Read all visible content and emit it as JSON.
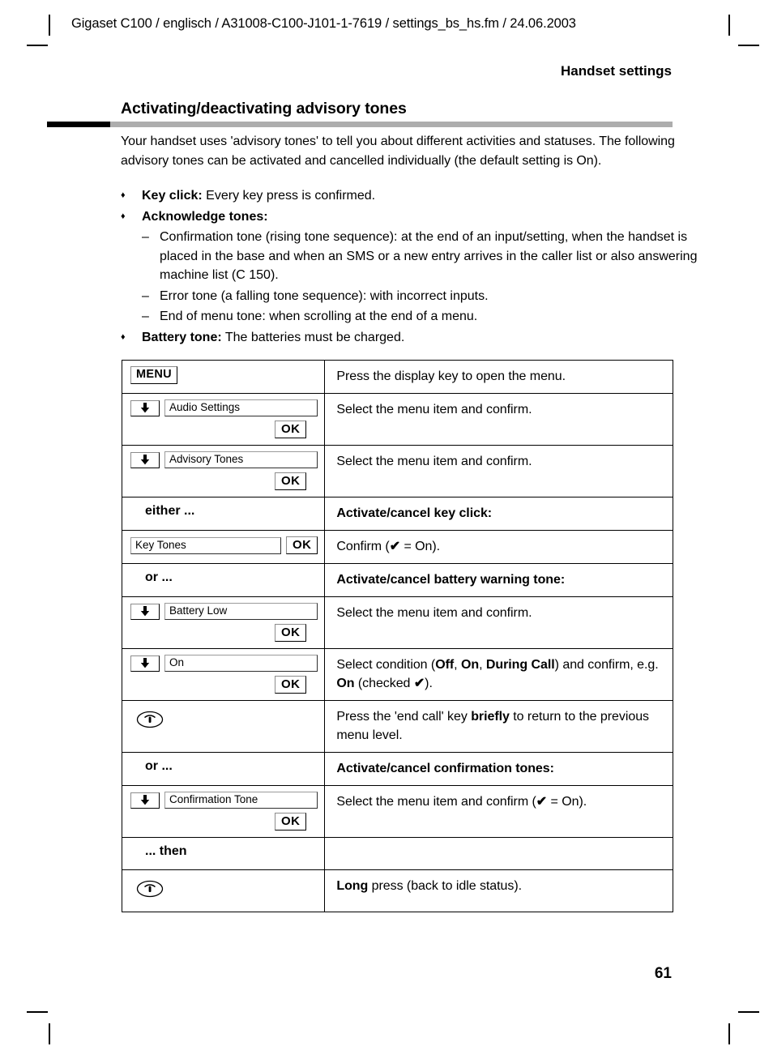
{
  "document_header": "Gigaset C100 / englisch / A31008-C100-J101-1-7619 / settings_bs_hs.fm / 24.06.2003",
  "section_header": "Handset settings",
  "chapter_title": "Activating/deactivating advisory tones",
  "intro_paragraph": "Your handset uses 'advisory tones' to tell you about different activities and statuses. The following advisory tones can be activated and cancelled individually (the default setting is On).",
  "bullets": [
    {
      "marker": "♦",
      "bold": "Key click:",
      "rest": " Every key press is confirmed."
    },
    {
      "marker": "♦",
      "bold": "Acknowledge tones:",
      "rest": ""
    },
    {
      "marker": "–",
      "bold": "",
      "rest": "Confirmation tone (rising tone sequence): at the end of an input/setting, when the handset is placed in the base and when an SMS or a new entry arrives in the caller list or also answering machine list (C 150)."
    },
    {
      "marker": "–",
      "bold": "",
      "rest": "Error tone (a falling tone sequence): with incorrect inputs."
    },
    {
      "marker": "–",
      "bold": "",
      "rest": "End of menu tone: when scrolling at the end of a menu."
    },
    {
      "marker": "♦",
      "bold": "Battery tone:",
      "rest": " The batteries must be charged."
    }
  ],
  "keys": {
    "menu_label": "MENU",
    "ok_label": "OK",
    "arrow_icon": "arrow-down-icon",
    "end_call_icon": "end-call-key-icon",
    "check_glyph": "✔"
  },
  "procedure_rows": [
    {
      "id": "menu",
      "left_type": "menu-key",
      "menu_key": "MENU",
      "right": "Press the display key to open the menu."
    },
    {
      "id": "audio-settings",
      "left_type": "arrow-item-ok",
      "display_item": "Audio Settings",
      "ok": "OK",
      "right": "Select the menu item and confirm."
    },
    {
      "id": "advisory-tones",
      "left_type": "arrow-item-ok",
      "display_item": "Advisory Tones",
      "ok": "OK",
      "right": "Select the menu item and confirm."
    },
    {
      "id": "either",
      "left_type": "label",
      "left": "either ...",
      "right_type": "label",
      "right": "Activate/cancel key click:"
    },
    {
      "id": "key-tones",
      "left_type": "item-ok-inline",
      "display_item": "Key Tones",
      "ok": "OK",
      "right_prefix": "Confirm (",
      "right_suffix": " = On)."
    },
    {
      "id": "or-battery",
      "left_type": "label",
      "left": "or ...",
      "right_type": "label",
      "right": "Activate/cancel battery warning tone:"
    },
    {
      "id": "battery-low",
      "left_type": "arrow-item-ok",
      "display_item": "Battery Low",
      "ok": "OK",
      "right": "Select the menu item and confirm."
    },
    {
      "id": "condition-on",
      "left_type": "arrow-item-ok",
      "display_item": "On",
      "ok": "OK",
      "right_rich": true
    },
    {
      "id": "end-call-brief",
      "left_type": "end-call",
      "right_rich": true
    },
    {
      "id": "or-confirmation",
      "left_type": "label",
      "left": "or ...",
      "right_type": "label",
      "right": "Activate/cancel confirmation tones:"
    },
    {
      "id": "confirmation-tone",
      "left_type": "arrow-item-ok",
      "display_item": "Confirmation Tone",
      "ok": "OK",
      "right_prefix": "Select the menu item and confirm (",
      "right_suffix": " = On)."
    },
    {
      "id": "then",
      "left_type": "label",
      "left": "... then",
      "right_type": "label",
      "right": ""
    },
    {
      "id": "end-call-long",
      "left_type": "end-call",
      "right_rich": true
    }
  ],
  "rich_text": {
    "condition_on": {
      "p1": "Select condition (",
      "opt1": "Off",
      "sep1": ", ",
      "opt2": "On",
      "sep2": ", ",
      "opt3": "During Call",
      "p2": ") and confirm, e.g. ",
      "opt4": "On",
      "p3": " (checked ",
      "p4": ")."
    },
    "end_call_brief": {
      "p1": "Press the 'end call' key ",
      "em": "briefly",
      "p2": " to return to the previous menu level."
    },
    "end_call_long": {
      "em": "Long",
      "p1": " press (back to idle status)."
    }
  },
  "page_number": "61",
  "colors": {
    "rule_black": "#000000",
    "rule_grey": "#adadad",
    "text": "#000000",
    "background": "#ffffff"
  }
}
